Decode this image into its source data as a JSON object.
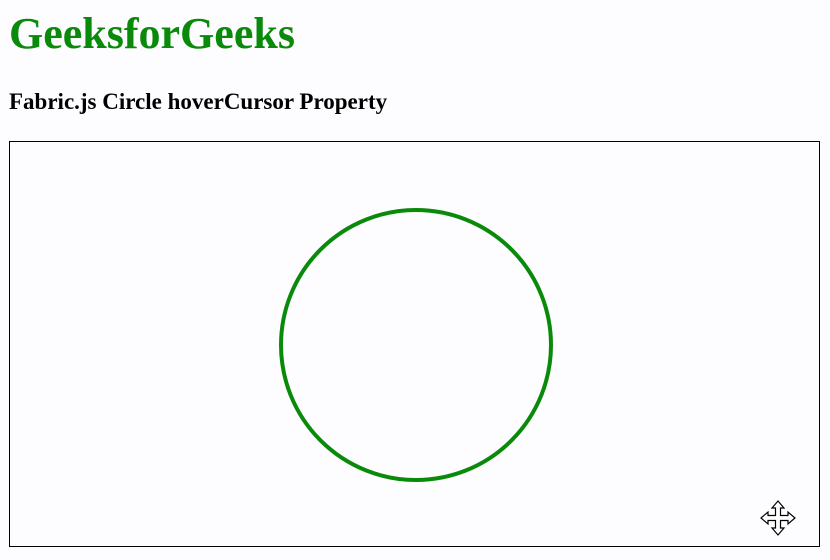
{
  "header": {
    "title": "GeeksforGeeks",
    "subtitle": "Fabric.js Circle hoverCursor Property"
  },
  "canvas": {
    "object": {
      "type": "circle",
      "stroke_color": "#0a8a0a",
      "fill": "transparent"
    },
    "hover_cursor": "move-icon"
  },
  "colors": {
    "brand_green": "#0a8a0a",
    "background": "#fdfcfe",
    "border": "#000000"
  }
}
